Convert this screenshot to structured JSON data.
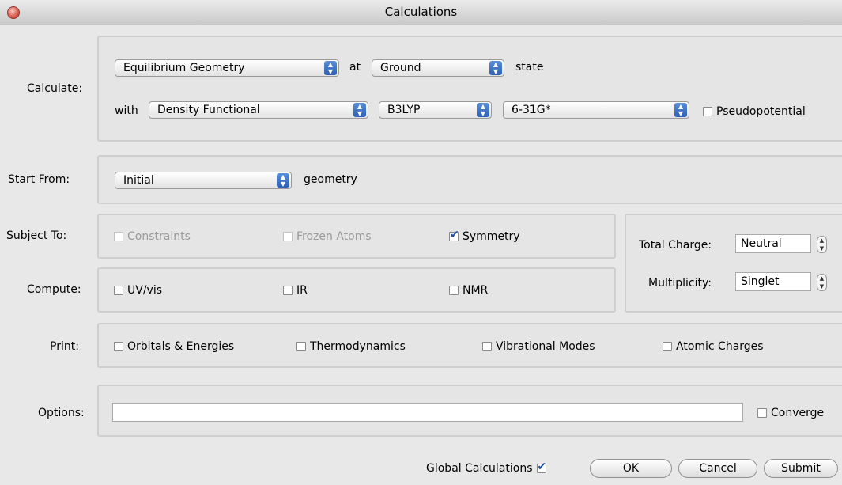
{
  "window": {
    "title": "Calculations"
  },
  "labels": {
    "calculate": "Calculate:",
    "start_from": "Start From:",
    "subject_to": "Subject To:",
    "compute": "Compute:",
    "print": "Print:",
    "options": "Options:"
  },
  "calculate": {
    "type_value": "Equilibrium Geometry",
    "at_text": "at",
    "state_value": "Ground",
    "state_text": "state",
    "with_text": "with",
    "method_value": "Density Functional",
    "functional_value": "B3LYP",
    "basis_value": "6-31G*",
    "pseudopotential_label": "Pseudopotential"
  },
  "start_from": {
    "value": "Initial",
    "suffix": "geometry"
  },
  "subject_to": {
    "constraints": "Constraints",
    "frozen_atoms": "Frozen Atoms",
    "symmetry": "Symmetry"
  },
  "compute": {
    "uvvis": "UV/vis",
    "ir": "IR",
    "nmr": "NMR"
  },
  "charge": {
    "total_charge_label": "Total Charge:",
    "total_charge_value": "Neutral",
    "multiplicity_label": "Multiplicity:",
    "multiplicity_value": "Singlet"
  },
  "print": {
    "orbitals": "Orbitals & Energies",
    "thermo": "Thermodynamics",
    "vibrational": "Vibrational Modes",
    "atomic_charges": "Atomic Charges"
  },
  "options": {
    "value": "",
    "converge_label": "Converge"
  },
  "footer": {
    "global_calculations": "Global Calculations",
    "ok": "OK",
    "cancel": "Cancel",
    "submit": "Submit"
  }
}
